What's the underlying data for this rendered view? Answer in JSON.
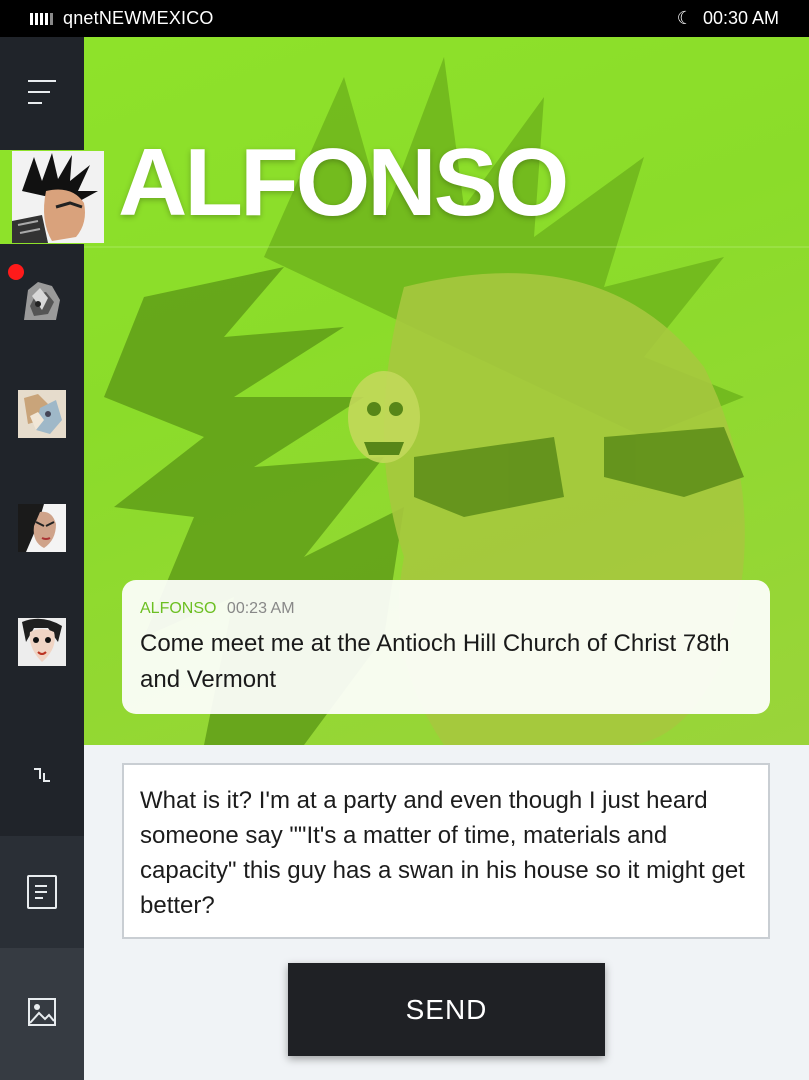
{
  "status_bar": {
    "carrier": "qnetNEWMEXICO",
    "time": "00:30 AM",
    "signal_icon": "signal-bars-icon",
    "night_icon": "moon-icon"
  },
  "sidebar": {
    "menu_icon": "hamburger-menu-icon",
    "contacts": [
      {
        "name": "contact-1",
        "unread": true
      },
      {
        "name": "contact-2",
        "unread": false
      },
      {
        "name": "contact-3",
        "unread": false
      },
      {
        "name": "contact-4",
        "unread": false
      }
    ],
    "collapse_icon": "collapse-icon",
    "journal_icon": "journal-icon",
    "gallery_icon": "image-gallery-icon"
  },
  "conversation": {
    "contact_name": "ALFONSO",
    "message": {
      "sender": "ALFONSO",
      "time": "00:23 AM",
      "text": "Come meet me at the Antioch Hill Church of Christ 78th and Vermont"
    }
  },
  "compose": {
    "value": "What is it? I'm at a party and even though I just heard someone say  \"\"It's a matter of time, materials and capacity\" this guy has a swan in his house so it might get better?",
    "send_label": "SEND"
  },
  "colors": {
    "accent_green": "#8ee22a",
    "sidebar_bg": "#20242a",
    "unread_dot": "#ff1a1a",
    "send_bg": "#1f2125"
  }
}
